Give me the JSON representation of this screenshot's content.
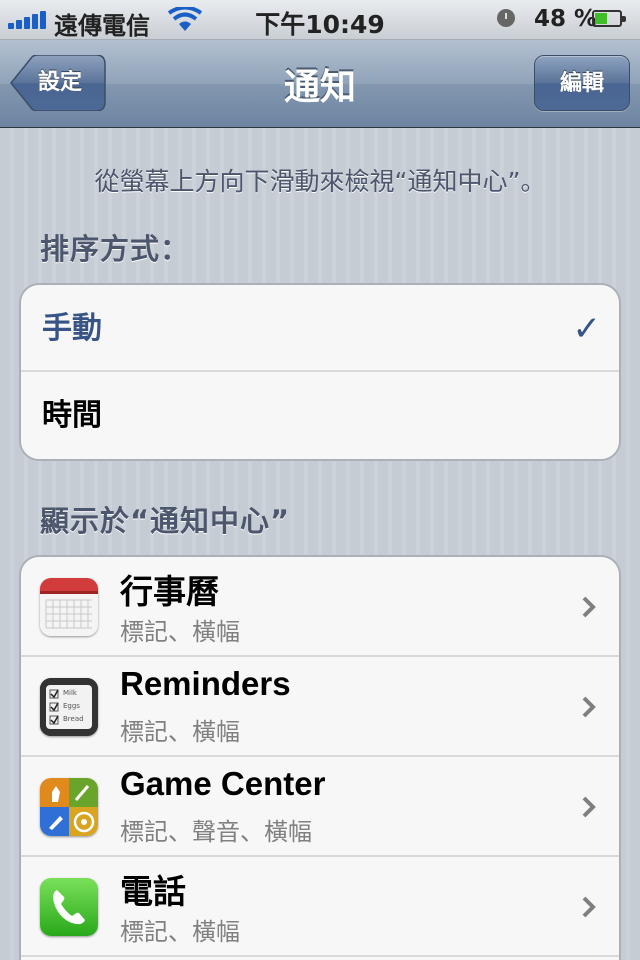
{
  "status_bar": {
    "carrier": "遠傳電信",
    "time": "下午10:49",
    "battery": "48 %",
    "battery_level": 0.48
  },
  "nav": {
    "back_label": "設定",
    "title": "通知",
    "edit_label": "編輯"
  },
  "hint": "從螢幕上方向下滑動來檢視“通知中心”。",
  "sort": {
    "header": "排序方式：",
    "options": [
      {
        "label": "手動",
        "selected": true
      },
      {
        "label": "時間",
        "selected": false
      }
    ],
    "check_glyph": "✓"
  },
  "center": {
    "header": "顯示於“通知中心”",
    "apps": [
      {
        "name": "行事曆",
        "subtitle": "標記、橫幅",
        "icon": "calendar-icon"
      },
      {
        "name": "Reminders",
        "subtitle": "標記、橫幅",
        "icon": "reminders-icon"
      },
      {
        "name": "Game Center",
        "subtitle": "標記、聲音、橫幅",
        "icon": "game-center-icon"
      },
      {
        "name": "電話",
        "subtitle": "標記、橫幅",
        "icon": "phone-icon"
      }
    ]
  },
  "reminders_icon_text": [
    "Milk",
    "Eggs",
    "Bread"
  ],
  "colors": {
    "selected_text": "#385487",
    "section_header": "#4c566c",
    "subtitle": "#808080"
  }
}
